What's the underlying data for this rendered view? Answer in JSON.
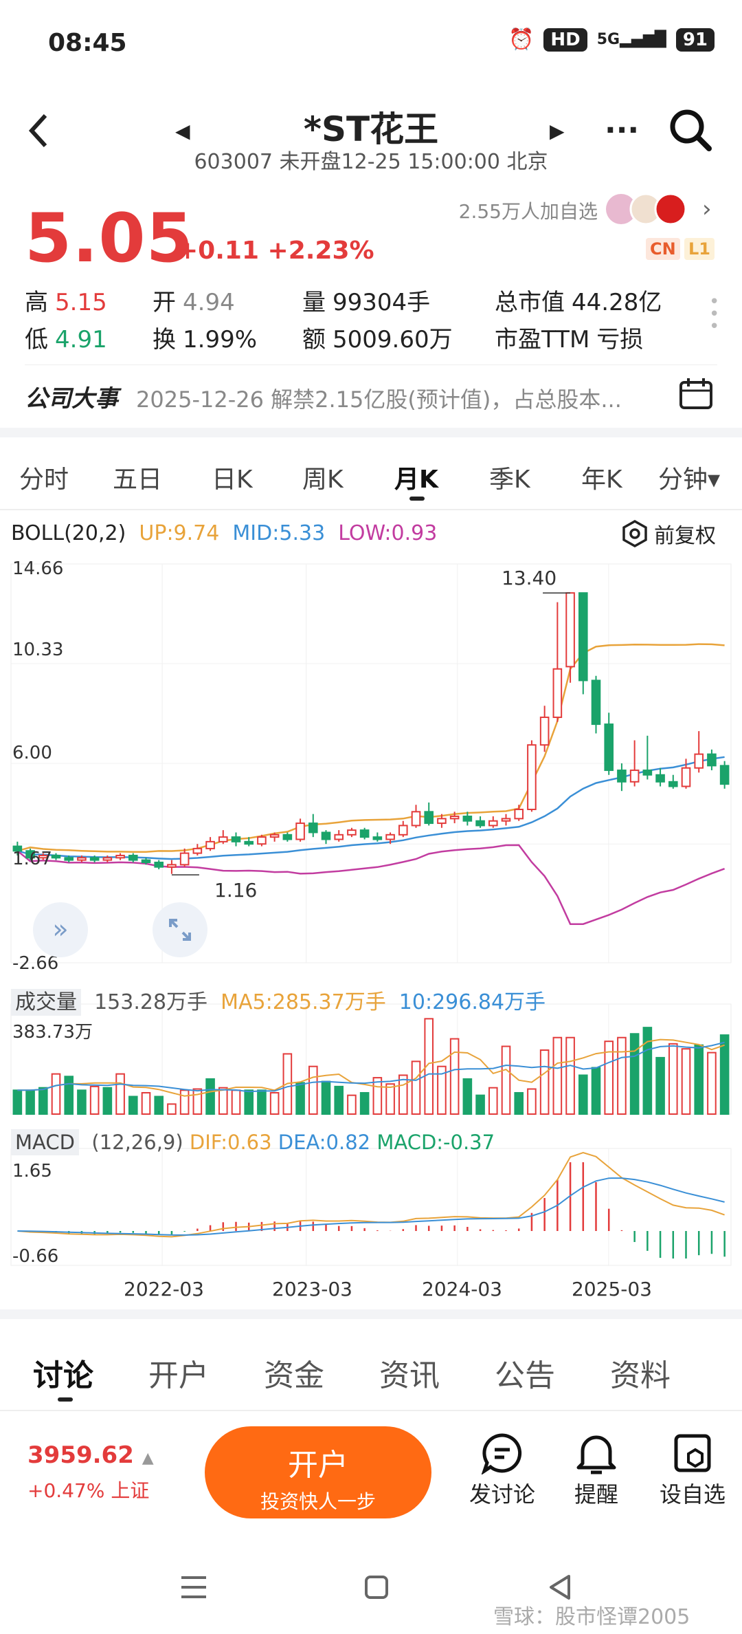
{
  "status_bar": {
    "time": "08:45",
    "hd": "HD",
    "net": "5G",
    "battery": "91"
  },
  "header": {
    "title": "*ST花王",
    "subtitle": "603007 未开盘12-25 15:00:00 北京"
  },
  "quote": {
    "price": "5.05",
    "change": "+0.11",
    "change_pct": "+2.23%",
    "followers": "2.55万人加自选",
    "badge_cn": "CN",
    "badge_l1": "L1",
    "stats": [
      {
        "label": "高",
        "value": "5.15",
        "color": "red"
      },
      {
        "label": "开",
        "value": "4.94",
        "color": "gray"
      },
      {
        "label": "量",
        "value": "99304手",
        "color": ""
      },
      {
        "label": "总市值",
        "value": "44.28亿",
        "color": ""
      },
      {
        "label": "低",
        "value": "4.91",
        "color": "green"
      },
      {
        "label": "换",
        "value": "1.99%",
        "color": ""
      },
      {
        "label": "额",
        "value": "5009.60万",
        "color": ""
      },
      {
        "label": "市盈TTM",
        "value": "亏损",
        "color": ""
      }
    ]
  },
  "events": {
    "label": "公司大事",
    "text": "2025-12-26 解禁2.15亿股(预计值)，占总股本..."
  },
  "period_tabs": [
    "分时",
    "五日",
    "日K",
    "周K",
    "月K",
    "季K",
    "年K",
    "分钟▾"
  ],
  "active_period": "月K",
  "chart_settings": {
    "adjust_label": "前复权"
  },
  "colors": {
    "up": "#e33b3b",
    "down": "#1aa36a",
    "boll_up": "#e8a33a",
    "boll_mid": "#3a8fd6",
    "boll_low": "#c23ca0",
    "accent": "#ff6a13"
  },
  "chart_data": [
    {
      "type": "candlestick",
      "indicator": "BOLL(20,2)",
      "legend": [
        {
          "name": "UP",
          "text": "UP:9.74",
          "color": "#e8a33a"
        },
        {
          "name": "MID",
          "text": "MID:5.33",
          "color": "#3a8fd6"
        },
        {
          "name": "LOW",
          "text": "LOW:0.93",
          "color": "#c23ca0"
        }
      ],
      "y_ticks": [
        "14.66",
        "10.33",
        "6.00",
        "1.67",
        "-2.66"
      ],
      "ylim": [
        -2.66,
        14.66
      ],
      "annotations": [
        {
          "text": "13.40",
          "value": 13.4
        },
        {
          "text": "1.16",
          "value": 1.16
        }
      ],
      "candles": [
        [
          2.4,
          2.2,
          2.6,
          2.0
        ],
        [
          2.2,
          1.9,
          2.3,
          1.8
        ],
        [
          1.9,
          2.0,
          2.1,
          1.8
        ],
        [
          2.0,
          1.9,
          2.1,
          1.8
        ],
        [
          1.9,
          1.8,
          2.0,
          1.7
        ],
        [
          1.8,
          1.9,
          2.0,
          1.7
        ],
        [
          1.9,
          1.8,
          2.0,
          1.7
        ],
        [
          1.8,
          1.9,
          2.0,
          1.7
        ],
        [
          1.9,
          2.0,
          2.1,
          1.8
        ],
        [
          2.0,
          1.8,
          2.1,
          1.7
        ],
        [
          1.8,
          1.7,
          1.9,
          1.6
        ],
        [
          1.7,
          1.5,
          1.8,
          1.4
        ],
        [
          1.5,
          1.6,
          1.8,
          1.2
        ],
        [
          1.6,
          2.1,
          2.3,
          1.5
        ],
        [
          2.1,
          2.3,
          2.5,
          2.0
        ],
        [
          2.3,
          2.6,
          2.8,
          2.2
        ],
        [
          2.6,
          2.8,
          3.1,
          2.5
        ],
        [
          2.8,
          2.6,
          3.0,
          2.4
        ],
        [
          2.6,
          2.5,
          2.8,
          2.4
        ],
        [
          2.5,
          2.8,
          2.9,
          2.4
        ],
        [
          2.8,
          2.9,
          3.0,
          2.6
        ],
        [
          2.9,
          2.7,
          3.0,
          2.6
        ],
        [
          2.7,
          3.4,
          3.6,
          2.6
        ],
        [
          3.4,
          3.0,
          3.8,
          2.8
        ],
        [
          3.0,
          2.7,
          3.1,
          2.5
        ],
        [
          2.7,
          2.9,
          3.1,
          2.6
        ],
        [
          2.9,
          3.1,
          3.2,
          2.8
        ],
        [
          3.1,
          2.8,
          3.2,
          2.7
        ],
        [
          2.8,
          2.7,
          3.0,
          2.6
        ],
        [
          2.7,
          2.9,
          3.0,
          2.5
        ],
        [
          2.9,
          3.3,
          3.5,
          2.8
        ],
        [
          3.3,
          3.9,
          4.2,
          3.2
        ],
        [
          3.9,
          3.4,
          4.3,
          3.3
        ],
        [
          3.4,
          3.6,
          3.8,
          3.2
        ],
        [
          3.6,
          3.7,
          3.9,
          3.4
        ],
        [
          3.7,
          3.5,
          3.9,
          3.3
        ],
        [
          3.5,
          3.3,
          3.7,
          3.2
        ],
        [
          3.3,
          3.5,
          3.7,
          3.2
        ],
        [
          3.5,
          3.6,
          3.8,
          3.3
        ],
        [
          3.6,
          4.0,
          4.2,
          3.5
        ],
        [
          4.0,
          6.8,
          7.0,
          3.9
        ],
        [
          6.8,
          8.0,
          8.5,
          6.5
        ],
        [
          8.0,
          10.1,
          13.0,
          7.8
        ],
        [
          10.2,
          13.4,
          13.4,
          9.5
        ],
        [
          13.4,
          9.6,
          13.4,
          9.0
        ],
        [
          9.6,
          7.7,
          9.8,
          7.3
        ],
        [
          7.7,
          5.7,
          8.2,
          5.5
        ],
        [
          5.7,
          5.2,
          6.0,
          4.8
        ],
        [
          5.2,
          5.7,
          7.0,
          5.0
        ],
        [
          5.7,
          5.5,
          7.2,
          5.3
        ],
        [
          5.5,
          5.2,
          5.8,
          5.0
        ],
        [
          5.2,
          5.0,
          5.5,
          4.9
        ],
        [
          5.0,
          5.8,
          6.2,
          4.9
        ],
        [
          5.8,
          6.4,
          7.4,
          5.6
        ],
        [
          6.4,
          5.9,
          6.6,
          5.7
        ],
        [
          5.9,
          5.1,
          6.1,
          4.9
        ]
      ],
      "ohlc_order": [
        "open",
        "close",
        "high",
        "low"
      ]
    },
    {
      "type": "bar",
      "title": "成交量",
      "legend": [
        {
          "name": "VOL",
          "text": "153.28万手",
          "color": "#555555"
        },
        {
          "name": "MA5",
          "text": "MA5:285.37万手",
          "color": "#e8a33a"
        },
        {
          "name": "MA10",
          "text": "10:296.84万手",
          "color": "#3a8fd6"
        }
      ],
      "y_ticks": [
        "383.73万"
      ],
      "ylim": [
        0,
        383.73
      ],
      "values": [
        95,
        95,
        105,
        160,
        150,
        95,
        110,
        105,
        160,
        70,
        85,
        70,
        40,
        95,
        100,
        140,
        105,
        95,
        95,
        95,
        85,
        240,
        125,
        190,
        130,
        110,
        75,
        85,
        145,
        120,
        155,
        210,
        380,
        190,
        300,
        140,
        75,
        105,
        270,
        85,
        100,
        255,
        305,
        305,
        155,
        185,
        290,
        305,
        320,
        345,
        225,
        280,
        260,
        275,
        245,
        315,
        205
      ],
      "directions": [
        "d",
        "d",
        "d",
        "u",
        "d",
        "d",
        "u",
        "d",
        "u",
        "d",
        "u",
        "d",
        "u",
        "u",
        "u",
        "d",
        "u",
        "u",
        "d",
        "d",
        "u",
        "u",
        "d",
        "u",
        "d",
        "d",
        "u",
        "d",
        "u",
        "u",
        "u",
        "u",
        "u",
        "u",
        "u",
        "d",
        "d",
        "u",
        "u",
        "d",
        "u",
        "u",
        "u",
        "u",
        "d",
        "d",
        "u",
        "u",
        "d",
        "d",
        "d",
        "u",
        "u",
        "d",
        "u",
        "d",
        "d"
      ]
    },
    {
      "type": "bar",
      "title": "MACD",
      "legend": [
        {
          "name": "params",
          "text": "(12,26,9)",
          "color": "#555555"
        },
        {
          "name": "DIF",
          "text": "DIF:0.63",
          "color": "#e8a33a"
        },
        {
          "name": "DEA",
          "text": "DEA:0.82",
          "color": "#3a8fd6"
        },
        {
          "name": "MACD",
          "text": "MACD:-0.37",
          "color": "#1aa36a"
        }
      ],
      "y_ticks": [
        "1.65",
        "-0.66"
      ],
      "ylim": [
        -0.66,
        1.65
      ],
      "x_ticks": [
        "2022-03",
        "2023-03",
        "2024-03",
        "2025-03"
      ]
    }
  ],
  "bottom_tabs": [
    "讨论",
    "开户",
    "资金",
    "资讯",
    "公告",
    "资料"
  ],
  "active_bottom_tab": "讨论",
  "index_quote": {
    "value": "3959.62",
    "change": "+0.47%",
    "name": "上证"
  },
  "open_account": {
    "label": "开户",
    "sub": "投资快人一步"
  },
  "tools": [
    {
      "label": "发讨论",
      "icon": "chat-icon"
    },
    {
      "label": "提醒",
      "icon": "bell-icon"
    },
    {
      "label": "设自选",
      "icon": "add-watchlist-icon"
    }
  ],
  "watermark": "雪球：股市怪谭2005"
}
